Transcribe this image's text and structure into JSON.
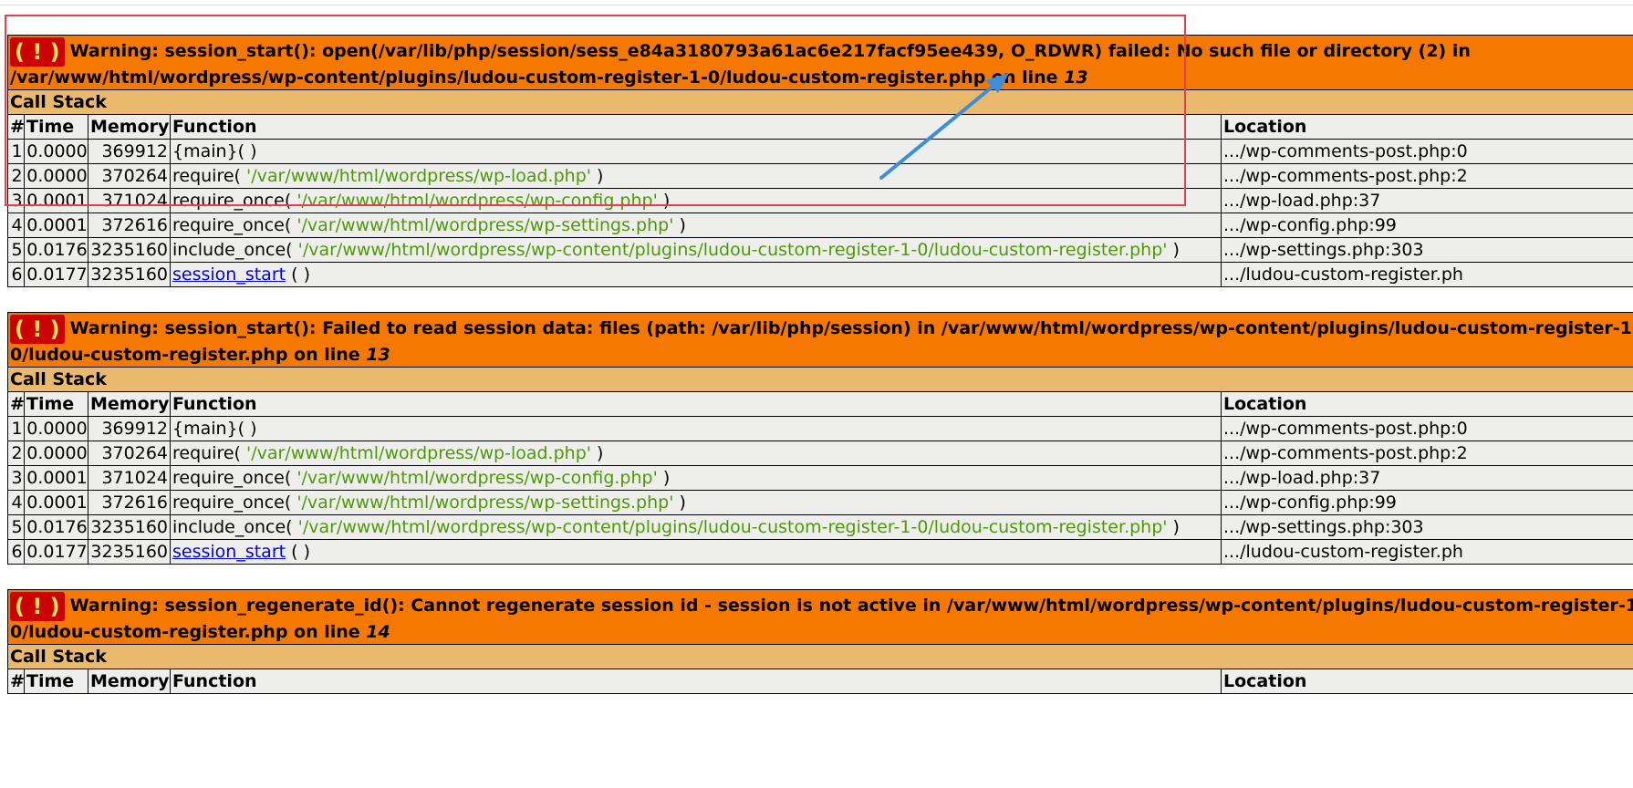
{
  "icon_symbol": "( ! )",
  "call_stack_label": "Call Stack",
  "columns": {
    "num": "#",
    "time": "Time",
    "memory": "Memory",
    "function": "Function",
    "location": "Location"
  },
  "colors": {
    "header_orange": "#f57900",
    "callstack_tan": "#e9b96e",
    "row_gray": "#eeeeec",
    "string_green": "#4e9a06",
    "annotation_red": "#e8404a",
    "annotation_arrow_blue": "#3b8fd9"
  },
  "errors": [
    {
      "message": "Warning: session_start(): open(/var/lib/php/session/sess_e84a3180793a61ac6e217facf95ee439, O_RDWR) failed: No such file or directory (2) in /var/www/html/wordpress/wp-content/plugins/ludou-custom-register-1-0/ludou-custom-register.php on line",
      "line": "13",
      "rows": [
        {
          "n": "1",
          "time": "0.0000",
          "mem": "369912",
          "fn": "{main}( )",
          "arg": "",
          "tail": "",
          "loc": ".../wp-comments-post.php:0"
        },
        {
          "n": "2",
          "time": "0.0000",
          "mem": "370264",
          "fn": "require( ",
          "arg": "'/var/www/html/wordpress/wp-load.php'",
          "tail": " )",
          "loc": ".../wp-comments-post.php:2"
        },
        {
          "n": "3",
          "time": "0.0001",
          "mem": "371024",
          "fn": "require_once( ",
          "arg": "'/var/www/html/wordpress/wp-config.php'",
          "tail": " )",
          "loc": ".../wp-load.php:37"
        },
        {
          "n": "4",
          "time": "0.0001",
          "mem": "372616",
          "fn": "require_once( ",
          "arg": "'/var/www/html/wordpress/wp-settings.php'",
          "tail": " )",
          "loc": ".../wp-config.php:99"
        },
        {
          "n": "5",
          "time": "0.0176",
          "mem": "3235160",
          "fn": "include_once( ",
          "arg": "'/var/www/html/wordpress/wp-content/plugins/ludou-custom-register-1-0/ludou-custom-register.php'",
          "tail": " )",
          "loc": ".../wp-settings.php:303"
        },
        {
          "n": "6",
          "time": "0.0177",
          "mem": "3235160",
          "fn_link": "session_start",
          "tail": " ( )",
          "loc": ".../ludou-custom-register.ph"
        }
      ]
    },
    {
      "message": "Warning: session_start(): Failed to read session data: files (path: /var/lib/php/session) in /var/www/html/wordpress/wp-content/plugins/ludou-custom-register-1-0/ludou-custom-register.php on line",
      "line": "13",
      "rows": [
        {
          "n": "1",
          "time": "0.0000",
          "mem": "369912",
          "fn": "{main}( )",
          "arg": "",
          "tail": "",
          "loc": ".../wp-comments-post.php:0"
        },
        {
          "n": "2",
          "time": "0.0000",
          "mem": "370264",
          "fn": "require( ",
          "arg": "'/var/www/html/wordpress/wp-load.php'",
          "tail": " )",
          "loc": ".../wp-comments-post.php:2"
        },
        {
          "n": "3",
          "time": "0.0001",
          "mem": "371024",
          "fn": "require_once( ",
          "arg": "'/var/www/html/wordpress/wp-config.php'",
          "tail": " )",
          "loc": ".../wp-load.php:37"
        },
        {
          "n": "4",
          "time": "0.0001",
          "mem": "372616",
          "fn": "require_once( ",
          "arg": "'/var/www/html/wordpress/wp-settings.php'",
          "tail": " )",
          "loc": ".../wp-config.php:99"
        },
        {
          "n": "5",
          "time": "0.0176",
          "mem": "3235160",
          "fn": "include_once( ",
          "arg": "'/var/www/html/wordpress/wp-content/plugins/ludou-custom-register-1-0/ludou-custom-register.php'",
          "tail": " )",
          "loc": ".../wp-settings.php:303"
        },
        {
          "n": "6",
          "time": "0.0177",
          "mem": "3235160",
          "fn_link": "session_start",
          "tail": " ( )",
          "loc": ".../ludou-custom-register.ph"
        }
      ]
    },
    {
      "message": "Warning: session_regenerate_id(): Cannot regenerate session id - session is not active in /var/www/html/wordpress/wp-content/plugins/ludou-custom-register-1-0/ludou-custom-register.php on line",
      "line": "14",
      "rows": []
    }
  ]
}
